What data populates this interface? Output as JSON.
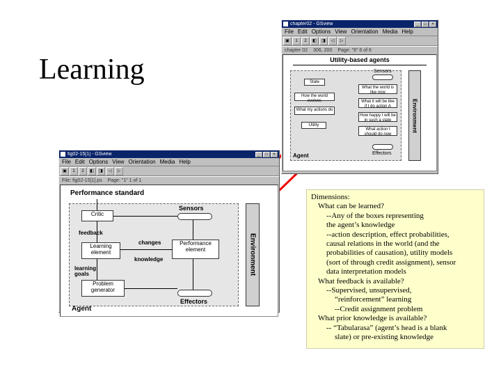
{
  "slide": {
    "title": "Learning"
  },
  "util_window": {
    "title": "chapter02 - GSview",
    "menu": {
      "file": "File",
      "edit": "Edit",
      "options": "Options",
      "view": "View",
      "orientation": "Orientation",
      "media": "Media",
      "help": "Help"
    },
    "status": {
      "left": "chapter 02",
      "mid": "306, 200",
      "right": "Page: \"6\"  6 of 6"
    },
    "heading": "Utility-based agents",
    "labels": {
      "sensors": "Sensors",
      "state": "State",
      "how_evolves": "How the world evolves",
      "what_actions": "What my actions do",
      "world_now": "What the world is like now",
      "world_ifA": "What it will be like if I do action A",
      "happy": "How happy I will be in such a state",
      "utility": "Utility",
      "action_now": "What action I should do now",
      "agent": "Agent",
      "effectors": "Effectors",
      "environment": "Environment"
    }
  },
  "learn_window": {
    "title": "fig02-15[1] - GSview",
    "menu": {
      "file": "File",
      "edit": "Edit",
      "options": "Options",
      "view": "View",
      "orientation": "Orientation",
      "media": "Media",
      "help": "Help"
    },
    "status": {
      "left": "File: fig02-15[1].ps",
      "right": "Page: \"1\"  1 of 1"
    },
    "labels": {
      "perf_std": "Performance standard",
      "critic": "Critic",
      "sensors": "Sensors",
      "feedback": "feedback",
      "changes": "changes",
      "knowledge": "knowledge",
      "learning_el": "Learning element",
      "perf_el": "Performance element",
      "learning_goals": "learning goals",
      "problem_gen": "Problem generator",
      "agent": "Agent",
      "effectors": "Effectors",
      "environment": "Environment"
    }
  },
  "note": {
    "heading": "Dimensions:",
    "q1": "What can be learned?",
    "q1a": "--Any of the boxes representing",
    "q1a2": "the agent’s knowledge",
    "q1b": "--action description, effect probabilities,",
    "q1b2": "causal relations in the world (and the",
    "q1b3": "probabilities of causation), utility models",
    "q1b4": "(sort of through credit assignment), sensor",
    "q1b5": "data interpretation models",
    "q2": "What feedback is available?",
    "q2a": "--Supervised, unsupervised,",
    "q2a2": "“reinforcement” learning",
    "q2b": "--Credit assignment problem",
    "q3": "What prior knowledge is available?",
    "q3a": "-- “Tabularasa” (agent’s head is a blank",
    "q3a2": "slate) or pre-existing knowledge"
  }
}
